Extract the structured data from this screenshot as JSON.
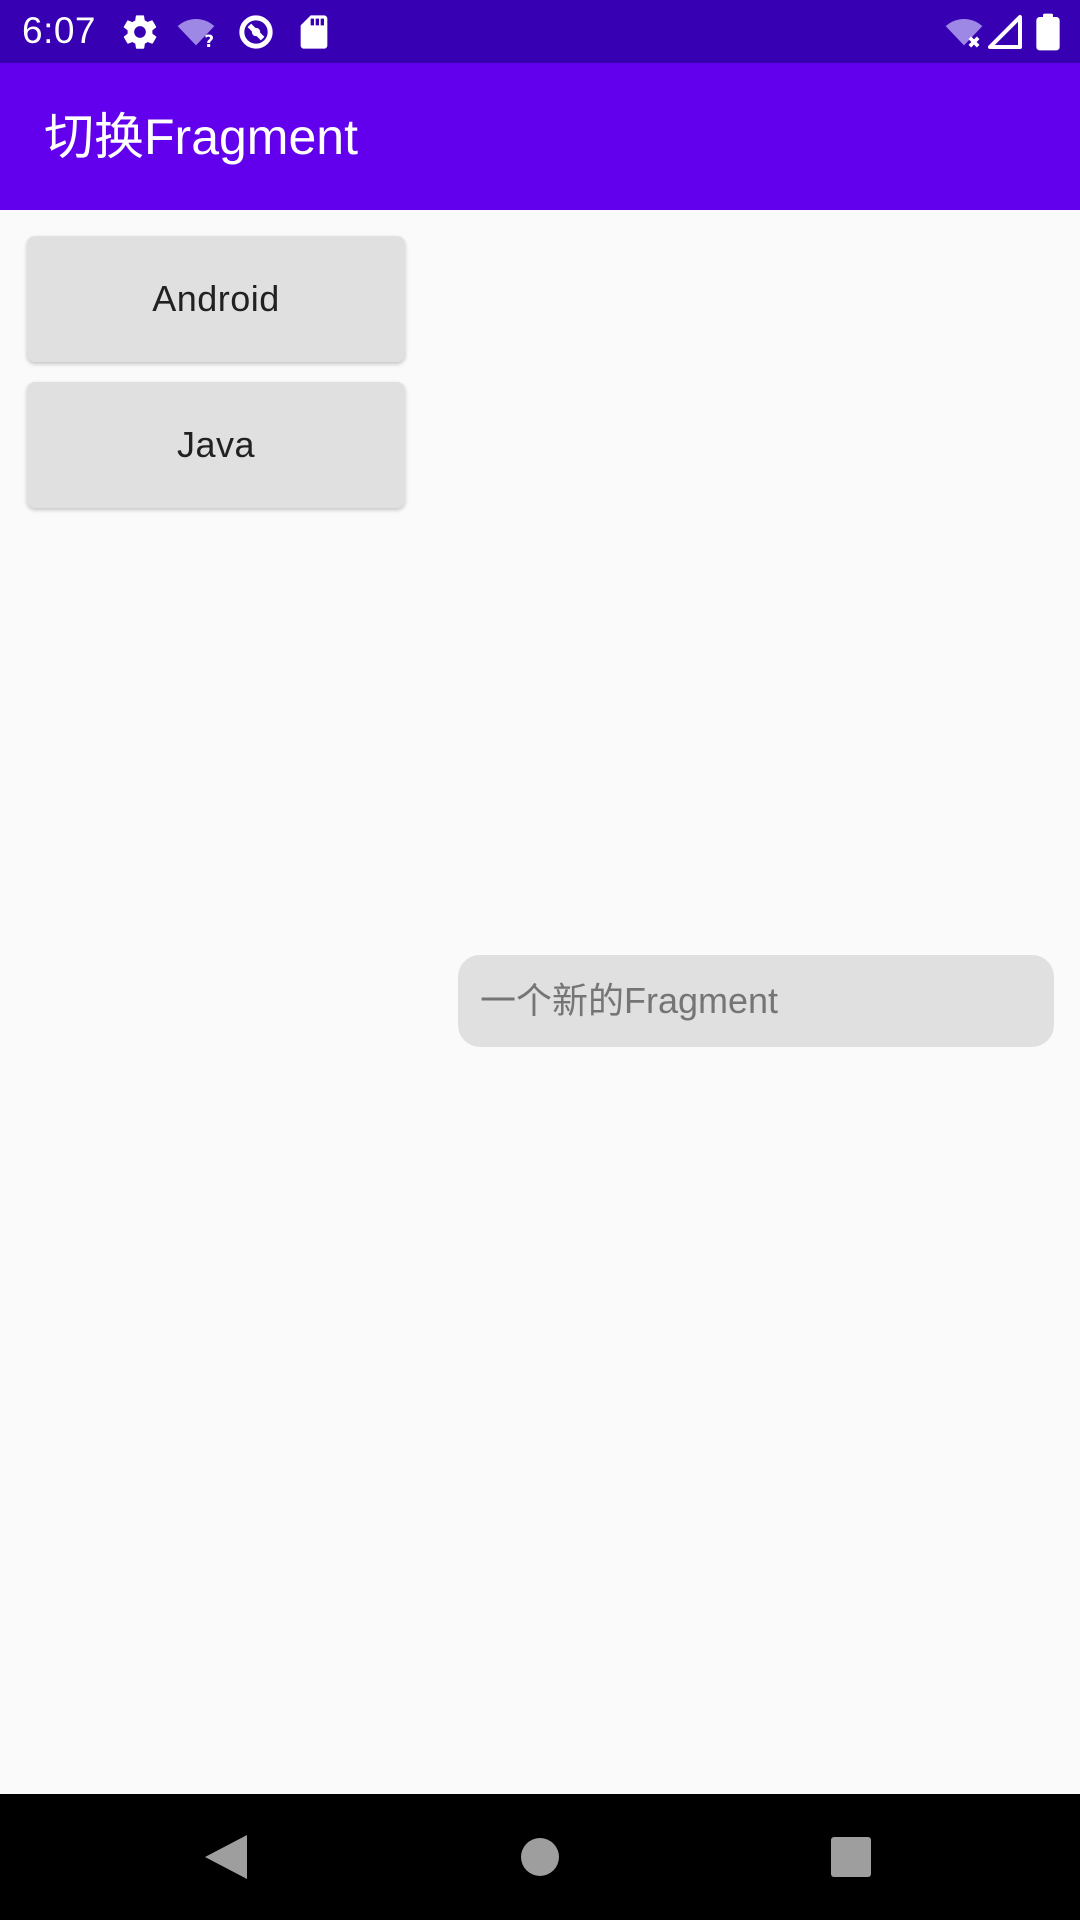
{
  "status_bar": {
    "time": "6:07",
    "icons": [
      "gear-icon",
      "wifi-question-icon",
      "sync-icon",
      "sd-card-icon",
      "wifi-off-icon",
      "signal-icon",
      "battery-icon"
    ]
  },
  "app_bar": {
    "title": "切换Fragment"
  },
  "buttons": {
    "android_label": "Android",
    "java_label": "Java"
  },
  "fragment": {
    "text": "一个新的Fragment"
  },
  "nav_bar": {
    "icons": [
      "back-icon",
      "home-icon",
      "recents-icon"
    ]
  },
  "colors": {
    "status_bar": "#3700b3",
    "app_bar": "#6200ee",
    "background": "#fafafa",
    "button": "#e0e0e0"
  }
}
